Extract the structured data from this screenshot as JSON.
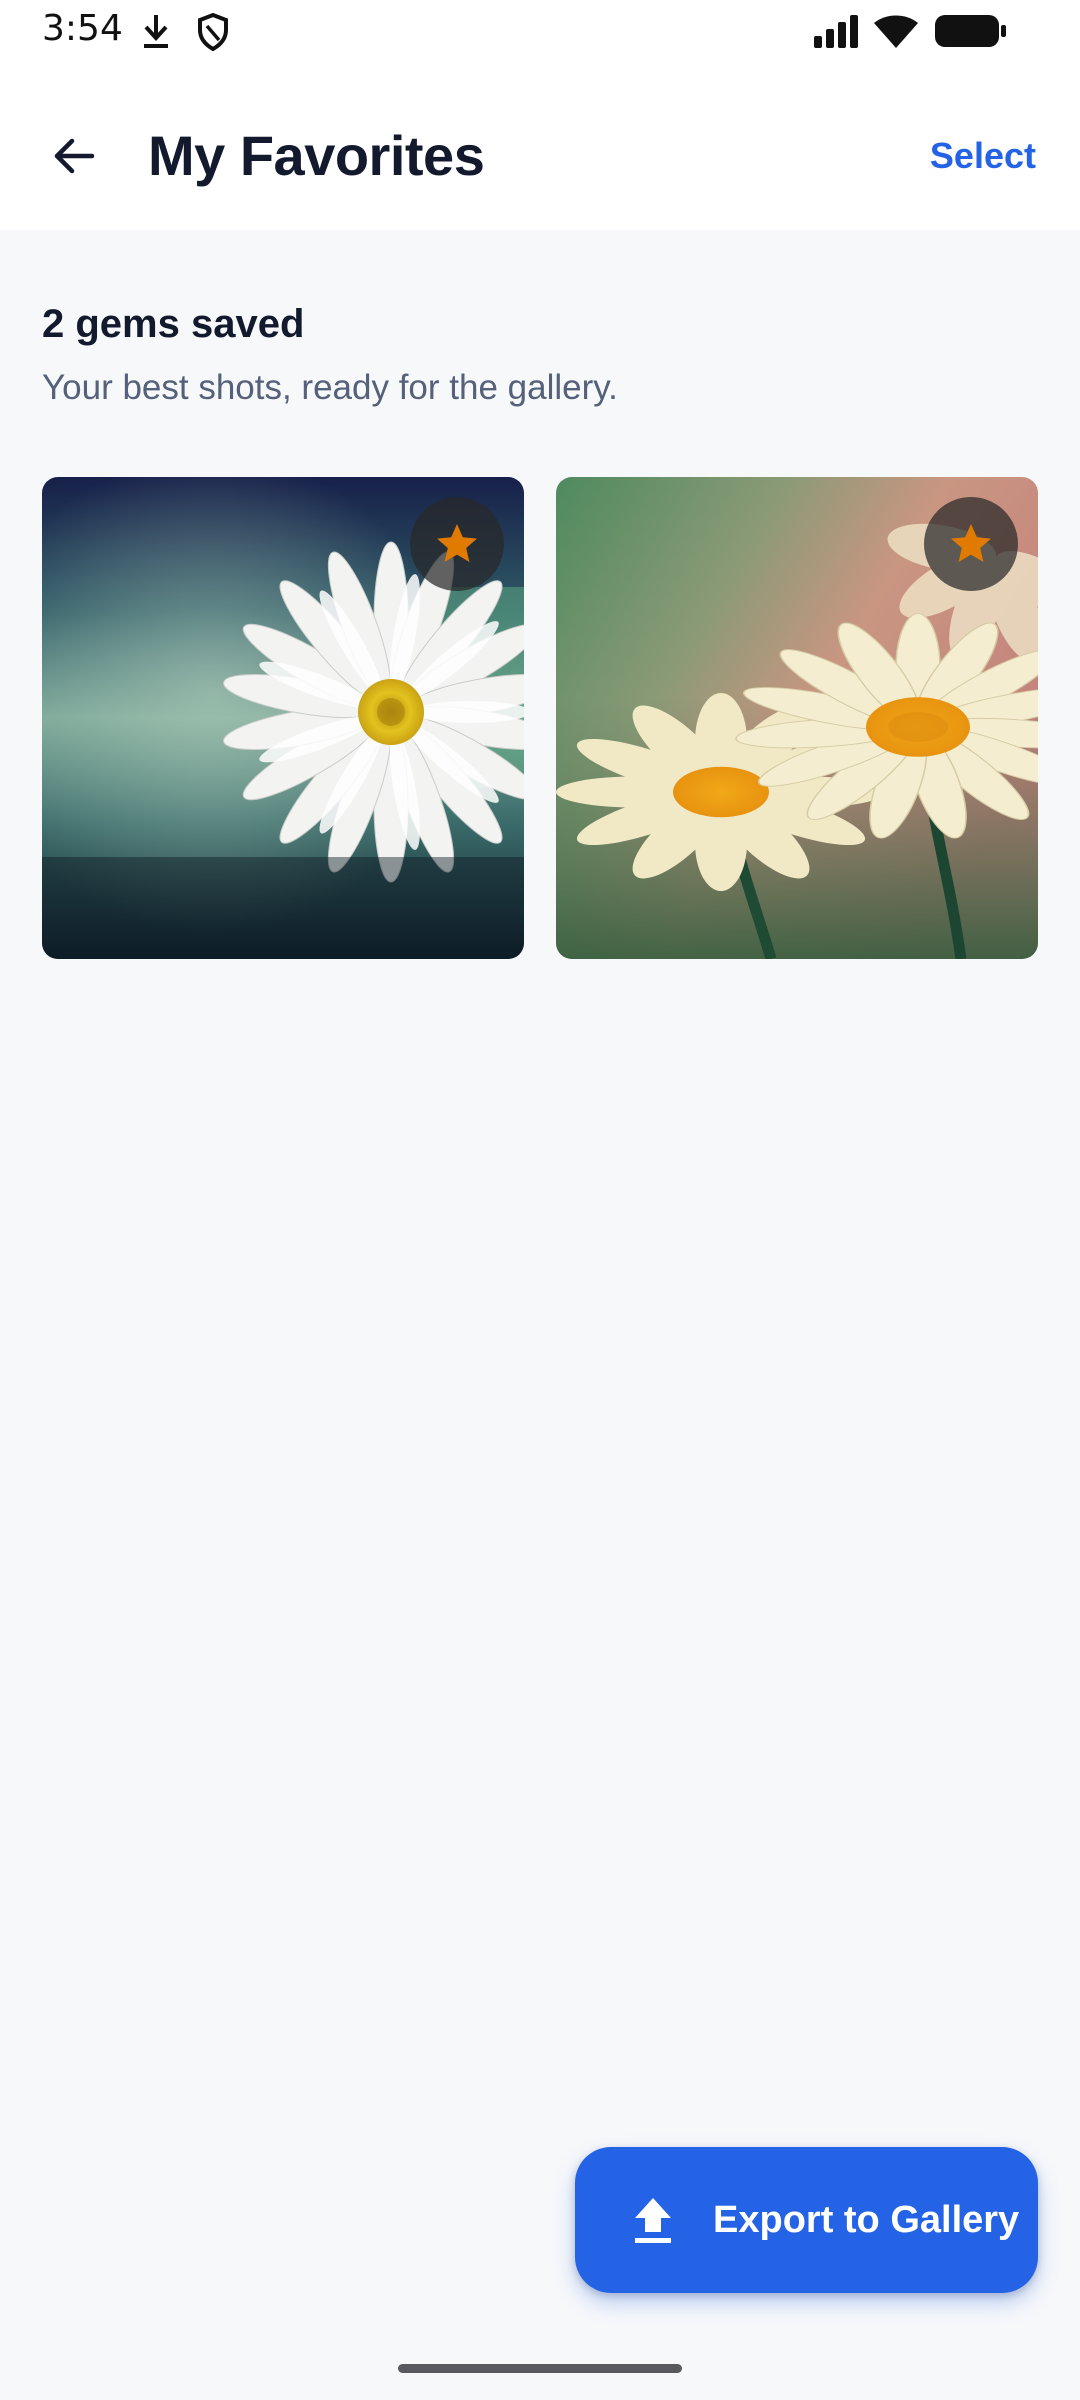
{
  "status_bar": {
    "time": "3:54",
    "left_icons": [
      "download-icon",
      "shield-icon"
    ],
    "right_icons": [
      "signal-icon",
      "wifi-icon",
      "battery-icon"
    ]
  },
  "app_bar": {
    "back_icon": "arrow-left-icon",
    "title": "My Favorites",
    "select_label": "Select"
  },
  "summary": {
    "count_text": "2 gems saved",
    "subtitle": "Your best shots, ready for the gallery."
  },
  "favorites": [
    {
      "subject": "white daisy on dark teal background",
      "badge_icon": "star-icon"
    },
    {
      "subject": "cream daisies on green and pink background",
      "badge_icon": "star-icon"
    }
  ],
  "fab": {
    "icon": "upload-icon",
    "label": "Export to Gallery"
  },
  "colors": {
    "accent": "#2462e6",
    "title_text": "#131a2e",
    "subtitle_text": "#55607a",
    "page_background": "#f7f8fa",
    "star": "#e07b00"
  }
}
